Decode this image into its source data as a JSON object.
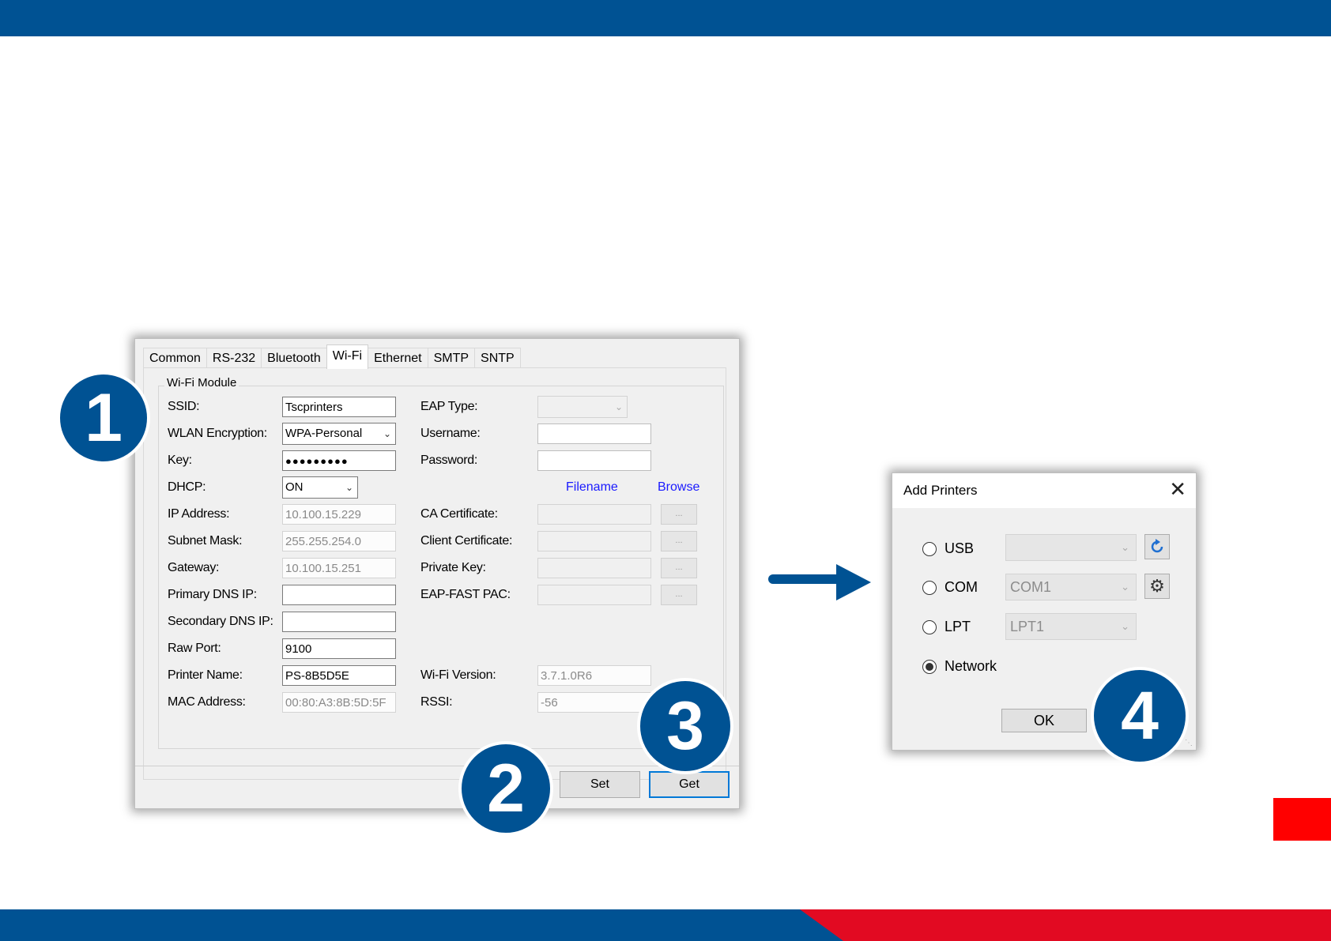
{
  "config_window": {
    "tabs": [
      "Common",
      "RS-232",
      "Bluetooth",
      "Wi-Fi",
      "Ethernet",
      "SMTP",
      "SNTP"
    ],
    "active_tab": "Wi-Fi",
    "group_label": "Wi-Fi Module",
    "left_fields": [
      {
        "label": "SSID:",
        "value": "Tscprinters",
        "state": "edit"
      },
      {
        "label": "WLAN Encryption:",
        "value": "WPA-Personal",
        "state": "combo"
      },
      {
        "label": "Key:",
        "value": "●●●●●●●●●",
        "state": "edit"
      },
      {
        "label": "DHCP:",
        "value": "ON",
        "state": "combo"
      },
      {
        "label": "IP Address:",
        "value": "10.100.15.229",
        "state": "disabled"
      },
      {
        "label": "Subnet Mask:",
        "value": "255.255.254.0",
        "state": "disabled"
      },
      {
        "label": "Gateway:",
        "value": "10.100.15.251",
        "state": "disabled"
      },
      {
        "label": "Primary DNS IP:",
        "value": "",
        "state": "edit"
      },
      {
        "label": "Secondary DNS IP:",
        "value": "",
        "state": "edit"
      },
      {
        "label": "Raw Port:",
        "value": "9100",
        "state": "edit"
      },
      {
        "label": "Printer Name:",
        "value": "PS-8B5D5E",
        "state": "edit"
      },
      {
        "label": "MAC Address:",
        "value": "00:80:A3:8B:5D:5F",
        "state": "disabled"
      }
    ],
    "right_fields": {
      "eap_type_label": "EAP Type:",
      "username_label": "Username:",
      "password_label": "Password:",
      "filename_header": "Filename",
      "browse_header": "Browse",
      "ca_cert_label": "CA Certificate:",
      "client_cert_label": "Client Certificate:",
      "private_key_label": "Private Key:",
      "eap_fast_pac_label": "EAP-FAST PAC:",
      "browse_button": "...",
      "wifi_version_label": "Wi-Fi Version:",
      "wifi_version_value": "3.7.1.0R6",
      "rssi_label": "RSSI:",
      "rssi_value": "-56"
    },
    "set_button": "Set",
    "get_button": "Get"
  },
  "add_printers": {
    "title": "Add Printers",
    "close_icon": "close-icon",
    "options": [
      {
        "label": "USB",
        "selected": false,
        "combo": "",
        "icon": "refresh-icon"
      },
      {
        "label": "COM",
        "selected": false,
        "combo": "COM1",
        "icon": "gear-icon"
      },
      {
        "label": "LPT",
        "selected": false,
        "combo": "LPT1",
        "icon": ""
      },
      {
        "label": "Network",
        "selected": true
      }
    ],
    "ok_button": "OK"
  },
  "steps": [
    "1",
    "2",
    "3",
    "4"
  ],
  "colors": {
    "brand_blue": "#005293",
    "brand_red": "#e20a22",
    "link_blue": "#1a1aff",
    "focus_blue": "#0078d7"
  }
}
